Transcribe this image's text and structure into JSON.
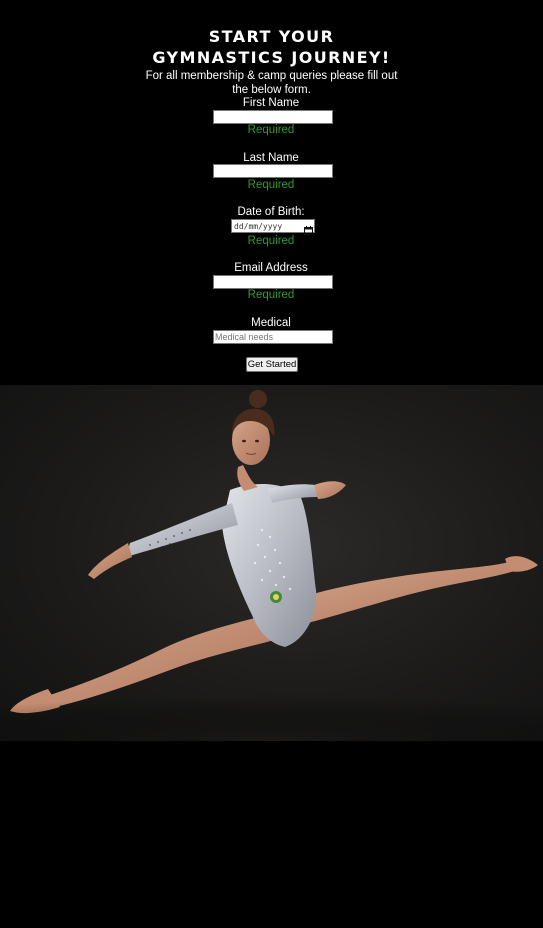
{
  "form": {
    "title": "START YOUR GYMNASTICS JOURNEY!",
    "intro": "For all membership & camp queries please fill out the below form.",
    "fields": {
      "first_name": {
        "label": "First Name",
        "value": "",
        "required_text": "Required"
      },
      "last_name": {
        "label": "Last Name",
        "value": "",
        "required_text": "Required"
      },
      "dob": {
        "label": "Date of Birth:",
        "placeholder": "dd/mm/yyyy",
        "required_text": "Required"
      },
      "email": {
        "label": "Email Address",
        "value": "",
        "required_text": "Required"
      },
      "medical": {
        "label": "Medical",
        "placeholder": "Medical needs"
      }
    },
    "submit_label": "Get Started"
  },
  "hero": {
    "image": "photo of a gymnast in a split leap wearing a silver leotard against a dark background"
  },
  "colors": {
    "background": "#000000",
    "text": "#ffffff",
    "required": "#2f9a2f",
    "leotard": "#c9ccd3",
    "skin": "#c99376"
  },
  "icons": {
    "date_picker": "calendar-icon"
  }
}
